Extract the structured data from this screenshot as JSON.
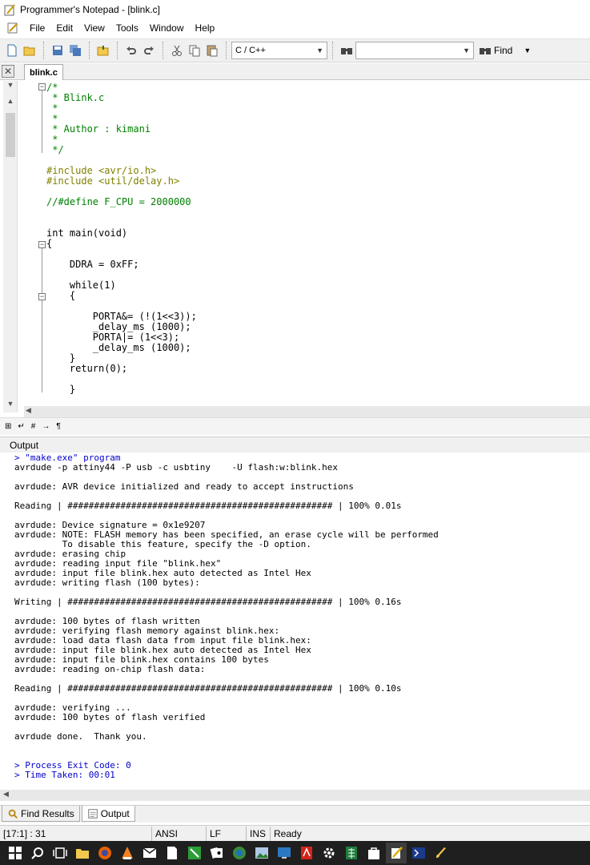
{
  "window": {
    "title": "Programmer's Notepad - [blink.c]"
  },
  "menu": [
    "File",
    "Edit",
    "View",
    "Tools",
    "Window",
    "Help"
  ],
  "toolbar": {
    "scheme": "C / C++",
    "find_label": "Find",
    "search_value": ""
  },
  "tab": {
    "label": "blink.c"
  },
  "code_lines": [
    {
      "text": "/*",
      "cls": "cm"
    },
    {
      "text": " * Blink.c",
      "cls": "cm"
    },
    {
      "text": " *",
      "cls": "cm"
    },
    {
      "text": " *",
      "cls": "cm"
    },
    {
      "text": " * Author : kimani",
      "cls": "cm"
    },
    {
      "text": " *",
      "cls": "cm"
    },
    {
      "text": " */",
      "cls": "cm"
    },
    {
      "text": "#include <avr/io.h>",
      "cls": "pp"
    },
    {
      "text": "#include <util/delay.h>",
      "cls": "pp"
    },
    {
      "text": "//#define F_CPU = 2000000",
      "cls": "cm"
    },
    {
      "text": "int main(void)",
      "cls": ""
    },
    {
      "text": "{",
      "cls": ""
    },
    {
      "text": "    DDRA = 0xFF;",
      "cls": ""
    },
    {
      "text": "    while(1)",
      "cls": ""
    },
    {
      "text": "    {",
      "cls": ""
    },
    {
      "text": "        PORTA&= (!(1<<3));",
      "cls": ""
    },
    {
      "text": "        _delay_ms (1000);",
      "cls": ""
    },
    {
      "text": "        PORTA|= (1<<3);",
      "cls": ""
    },
    {
      "text": "        _delay_ms (1000);",
      "cls": ""
    },
    {
      "text": "    }",
      "cls": ""
    },
    {
      "text": "    return(0);",
      "cls": ""
    },
    {
      "text": "    }",
      "cls": ""
    }
  ],
  "output_title": "Output",
  "output_lines": [
    {
      "text": "> \"make.exe\" program",
      "cls": "blue"
    },
    {
      "text": "avrdude -p attiny44 -P usb -c usbtiny    -U flash:w:blink.hex",
      "cls": ""
    },
    {
      "text": "",
      "cls": ""
    },
    {
      "text": "avrdude: AVR device initialized and ready to accept instructions",
      "cls": ""
    },
    {
      "text": "",
      "cls": ""
    },
    {
      "text": "Reading | ################################################## | 100% 0.01s",
      "cls": ""
    },
    {
      "text": "",
      "cls": ""
    },
    {
      "text": "avrdude: Device signature = 0x1e9207",
      "cls": ""
    },
    {
      "text": "avrdude: NOTE: FLASH memory has been specified, an erase cycle will be performed",
      "cls": ""
    },
    {
      "text": "         To disable this feature, specify the -D option.",
      "cls": ""
    },
    {
      "text": "avrdude: erasing chip",
      "cls": ""
    },
    {
      "text": "avrdude: reading input file \"blink.hex\"",
      "cls": ""
    },
    {
      "text": "avrdude: input file blink.hex auto detected as Intel Hex",
      "cls": ""
    },
    {
      "text": "avrdude: writing flash (100 bytes):",
      "cls": ""
    },
    {
      "text": "",
      "cls": ""
    },
    {
      "text": "Writing | ################################################## | 100% 0.16s",
      "cls": ""
    },
    {
      "text": "",
      "cls": ""
    },
    {
      "text": "avrdude: 100 bytes of flash written",
      "cls": ""
    },
    {
      "text": "avrdude: verifying flash memory against blink.hex:",
      "cls": ""
    },
    {
      "text": "avrdude: load data flash data from input file blink.hex:",
      "cls": ""
    },
    {
      "text": "avrdude: input file blink.hex auto detected as Intel Hex",
      "cls": ""
    },
    {
      "text": "avrdude: input file blink.hex contains 100 bytes",
      "cls": ""
    },
    {
      "text": "avrdude: reading on-chip flash data:",
      "cls": ""
    },
    {
      "text": "",
      "cls": ""
    },
    {
      "text": "Reading | ################################################## | 100% 0.10s",
      "cls": ""
    },
    {
      "text": "",
      "cls": ""
    },
    {
      "text": "avrdude: verifying ...",
      "cls": ""
    },
    {
      "text": "avrdude: 100 bytes of flash verified",
      "cls": ""
    },
    {
      "text": "",
      "cls": ""
    },
    {
      "text": "avrdude done.  Thank you.",
      "cls": ""
    },
    {
      "text": "",
      "cls": ""
    },
    {
      "text": "",
      "cls": ""
    },
    {
      "text": "> Process Exit Code: 0",
      "cls": "blue"
    },
    {
      "text": "> Time Taken: 00:01",
      "cls": "blue"
    }
  ],
  "bottom_tabs": {
    "find_results": "Find Results",
    "output": "Output"
  },
  "status": {
    "position": "[17:1] : 31",
    "encoding": "ANSI",
    "line_ending": "LF",
    "insert_mode": "INS",
    "state": "Ready"
  },
  "colors": {
    "comment": "#008000",
    "keyword": "#0000ff",
    "preprocessor": "#808000",
    "number": "#0080ff",
    "output_info": "#0000cc"
  }
}
